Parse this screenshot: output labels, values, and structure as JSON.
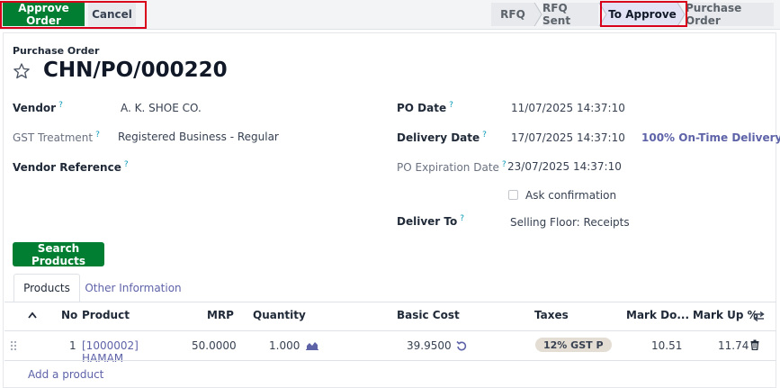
{
  "toolbar": {
    "approve_label": "Approve Order",
    "cancel_label": "Cancel"
  },
  "statusbar": {
    "steps": [
      {
        "label": "RFQ",
        "active": false
      },
      {
        "label": "RFQ Sent",
        "active": false
      },
      {
        "label": "To Approve",
        "active": true
      },
      {
        "label": "Purchase Order",
        "active": false
      }
    ]
  },
  "form": {
    "record_type": "Purchase Order",
    "name": "CHN/PO/000220",
    "vendor": {
      "label": "Vendor",
      "value": "A. K. SHOE CO."
    },
    "gst_treatment": {
      "label": "GST Treatment",
      "value": "Registered Business - Regular"
    },
    "vendor_reference": {
      "label": "Vendor Reference",
      "value": ""
    },
    "po_date": {
      "label": "PO Date",
      "value": "11/07/2025 14:37:10"
    },
    "delivery_date": {
      "label": "Delivery Date",
      "value": "17/07/2025 14:37:10",
      "on_time": "100% On-Time Delivery"
    },
    "po_expiration_date": {
      "label": "PO Expiration Date",
      "value": "23/07/2025 14:37:10"
    },
    "ask_confirmation": {
      "label": "Ask confirmation",
      "checked": false
    },
    "deliver_to": {
      "label": "Deliver To",
      "value": "Selling Floor: Receipts"
    },
    "help_mark": "?"
  },
  "search_products_label": "Search Products",
  "tabs": [
    {
      "label": "Products",
      "active": true
    },
    {
      "label": "Other Information",
      "active": false
    }
  ],
  "lines": {
    "columns": [
      "No",
      "Product",
      "MRP",
      "Quantity",
      "Basic Cost",
      "Taxes",
      "Mark Do...",
      "Mark Up %"
    ],
    "rows": [
      {
        "no": "1",
        "product": "[1000002] HAMAM",
        "mrp": "50.0000",
        "quantity": "1.000",
        "basic_cost": "39.9500",
        "taxes": "12% GST P",
        "mark_down": "10.51",
        "mark_up": "11.74"
      }
    ],
    "add_line_label": "Add a product"
  },
  "colors": {
    "primary": "#017e32",
    "highlight_outline": "#d9001b",
    "link": "#5e63a8",
    "help": "#0a9ab7"
  },
  "icons": {
    "favorite": "star-outline-icon",
    "sort": "chevron-up-icon",
    "optional_columns": "arrows-icon",
    "forecast": "area-chart-icon",
    "reset": "undo-icon",
    "delete": "trash-icon",
    "drag": "drag-handle-icon"
  }
}
